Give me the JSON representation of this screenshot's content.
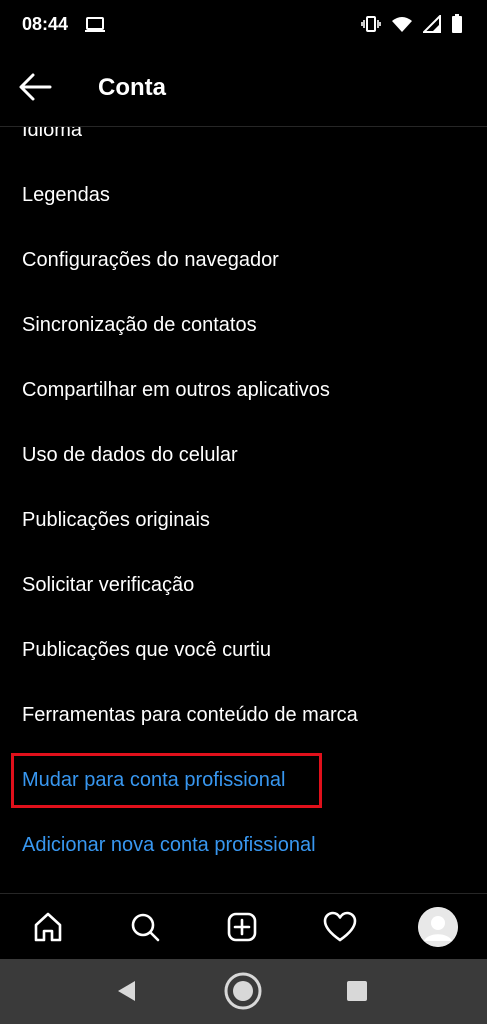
{
  "status_bar": {
    "time": "08:44",
    "icons": [
      "laptop-icon",
      "vibrate-icon",
      "wifi-icon",
      "signal-icon",
      "battery-icon"
    ]
  },
  "header": {
    "title": "Conta",
    "back_icon": "arrow-left-icon"
  },
  "menu": {
    "items": [
      {
        "label": "Idioma"
      },
      {
        "label": "Legendas"
      },
      {
        "label": "Configurações do navegador"
      },
      {
        "label": "Sincronização de contatos"
      },
      {
        "label": "Compartilhar em outros aplicativos"
      },
      {
        "label": "Uso de dados do celular"
      },
      {
        "label": "Publicações originais"
      },
      {
        "label": "Solicitar verificação"
      },
      {
        "label": "Publicações que você curtiu"
      },
      {
        "label": "Ferramentas para conteúdo de marca"
      },
      {
        "label": "Mudar para conta profissional",
        "highlighted": true
      },
      {
        "label": "Adicionar nova conta profissional"
      }
    ],
    "link_color": "#3897f0",
    "highlight_color": "#e0101b"
  },
  "bottom_nav": {
    "items": [
      "home-icon",
      "search-icon",
      "add-post-icon",
      "activity-heart-icon",
      "profile-avatar"
    ]
  },
  "system_nav": {
    "items": [
      "back-triangle-icon",
      "home-circle-icon",
      "recents-square-icon"
    ]
  }
}
